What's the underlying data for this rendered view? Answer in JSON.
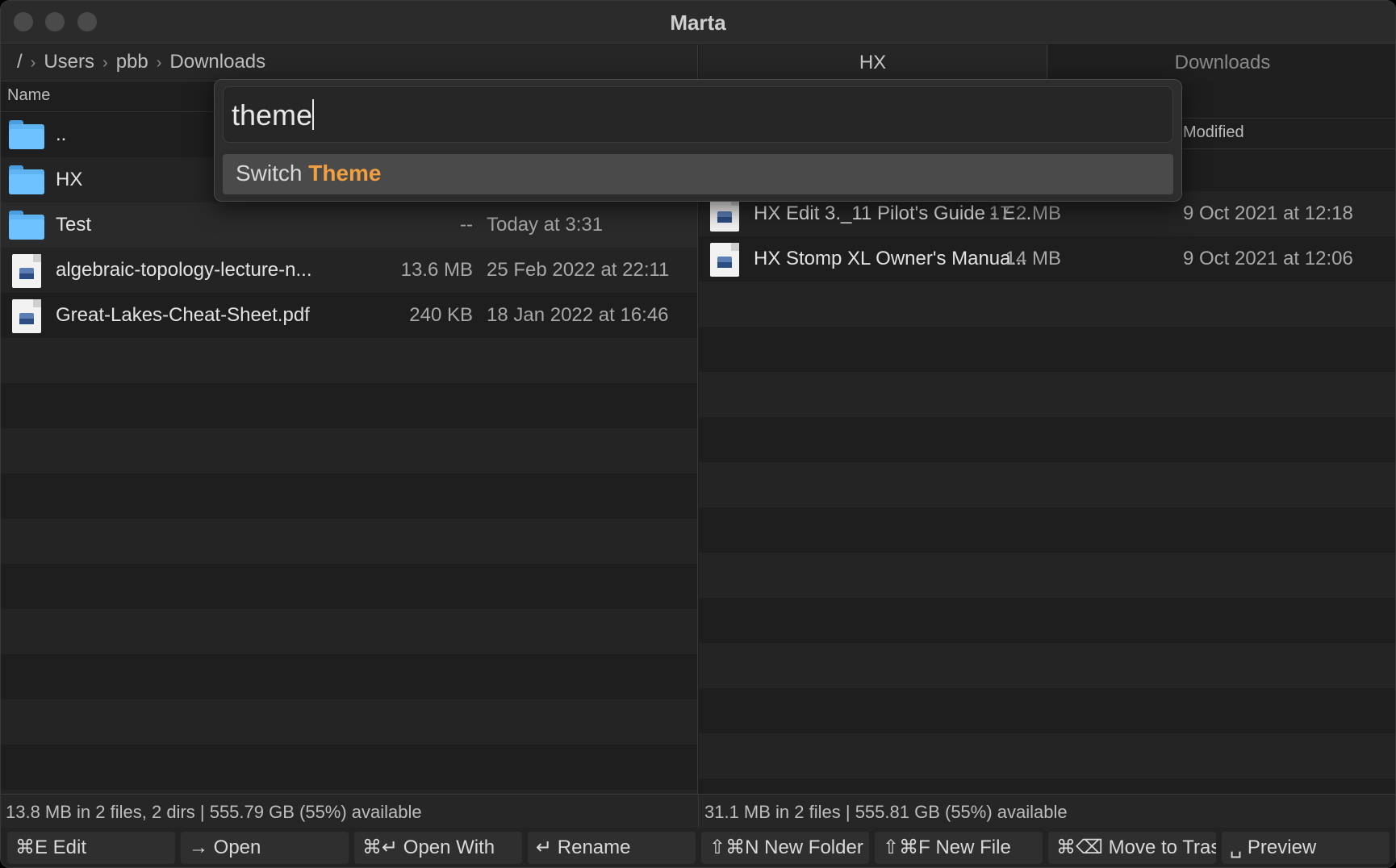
{
  "window": {
    "title": "Marta"
  },
  "left_pane": {
    "breadcrumb": [
      "/",
      "Users",
      "pbb",
      "Downloads"
    ],
    "column_name": "Name",
    "rows": [
      {
        "kind": "folder",
        "name": "..",
        "size": "",
        "date": ""
      },
      {
        "kind": "folder",
        "name": "HX",
        "size": "",
        "date": ""
      },
      {
        "kind": "folder",
        "name": "Test",
        "size": "--",
        "date": "Today at 3:31"
      },
      {
        "kind": "file",
        "name": "algebraic-topology-lecture-n...",
        "size": "13.6 MB",
        "date": "25 Feb 2022 at 22:11"
      },
      {
        "kind": "file",
        "name": "Great-Lakes-Cheat-Sheet.pdf",
        "size": "240 KB",
        "date": "18 Jan 2022 at 16:46"
      }
    ],
    "status": "13.8 MB in 2 files, 2 dirs  |  555.79 GB (55%) available"
  },
  "right_pane": {
    "tabs": [
      "HX",
      "Downloads"
    ],
    "column_modified": "Modified",
    "rows": [
      {
        "kind": "file",
        "name": "HX Edit 3._11 Pilot's Guide - E...",
        "size": "17.2 MB",
        "date": "9 Oct 2021 at 12:18"
      },
      {
        "kind": "file",
        "name": "HX Stomp XL Owner's Manua...",
        "size": "14 MB",
        "date": "9 Oct 2021 at 12:06"
      }
    ],
    "status": "31.1 MB in 2 files  |  555.81 GB (55%) available"
  },
  "palette": {
    "query": "theme",
    "result_prefix": "Switch ",
    "result_highlight": "Theme"
  },
  "actions": [
    "⌘E Edit",
    "→ Open",
    "⌘↵ Open With",
    "↵ Rename",
    "⇧⌘N New Folder",
    "⇧⌘F New File",
    "⌘⌫ Move to Trash",
    "␣ Preview"
  ],
  "colors": {
    "accent": "#f0a040",
    "folder": "#6ec2ff",
    "background": "#1e1e1e"
  }
}
